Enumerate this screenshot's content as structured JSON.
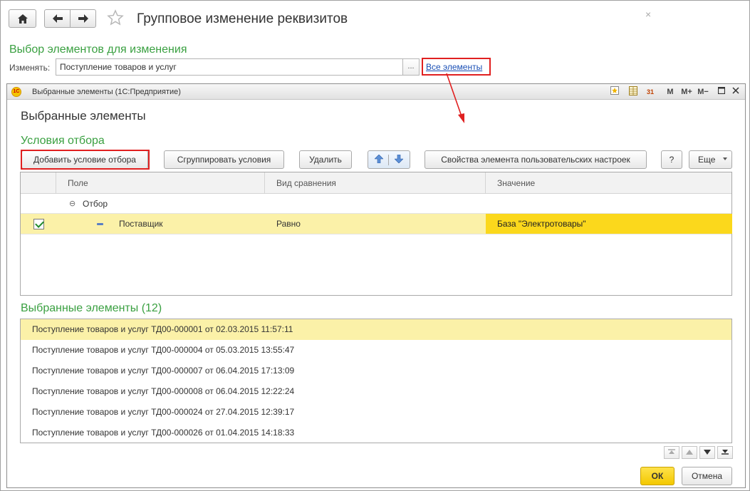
{
  "header": {
    "title": "Групповое изменение реквизитов",
    "home_icon": "home-icon",
    "back_icon": "arrow-left-icon",
    "forward_icon": "arrow-right-icon",
    "favorite_icon": "star-icon",
    "close_glyph": "×"
  },
  "selection": {
    "heading": "Выбор элементов для изменения",
    "change_label": "Изменять:",
    "change_value": "Поступление товаров и услуг",
    "choose_button": "...",
    "all_elements_link": "Все элементы"
  },
  "dialog": {
    "window_caption": "Выбранные элементы  (1С:Предприятие)",
    "logo_text": "1С",
    "toolbar": {
      "m": "M",
      "m_plus": "M+",
      "m_minus": "M−",
      "calendar": "31"
    },
    "title": "Выбранные элементы",
    "filter_heading": "Условия отбора",
    "buttons": {
      "add_condition": "Добавить условие отбора",
      "group_conditions": "Сгруппировать условия",
      "delete": "Удалить",
      "properties": "Свойства элемента пользовательских настроек",
      "help": "?",
      "more": "Еще"
    },
    "grid": {
      "columns": [
        "Поле",
        "Вид сравнения",
        "Значение"
      ],
      "group_row": {
        "toggle": "⊖",
        "label": "Отбор"
      },
      "rows": [
        {
          "checked": true,
          "field": "Поставщик",
          "comparison": "Равно",
          "value": "База \"Электротовары\""
        }
      ]
    },
    "list_heading": "Выбранные элементы (12)",
    "list_items": [
      "Поступление товаров и услуг ТД00-000001 от 02.03.2015 11:57:11",
      "Поступление товаров и услуг ТД00-000004 от 05.03.2015 13:55:47",
      "Поступление товаров и услуг ТД00-000007 от 06.04.2015 17:13:09",
      "Поступление товаров и услуг ТД00-000008 от 06.04.2015 12:22:24",
      "Поступление товаров и услуг ТД00-000024 от 27.04.2015 12:39:17",
      "Поступление товаров и услуг ТД00-000026 от 01.04.2015 14:18:33"
    ],
    "ok": "ОК",
    "cancel": "Отмена"
  },
  "colors": {
    "accent_green": "#3aa041",
    "highlight_yellow": "#fbf1a8",
    "value_yellow": "#fbd81c",
    "annotation_red": "#e02020",
    "link_blue": "#1a4fb5"
  }
}
